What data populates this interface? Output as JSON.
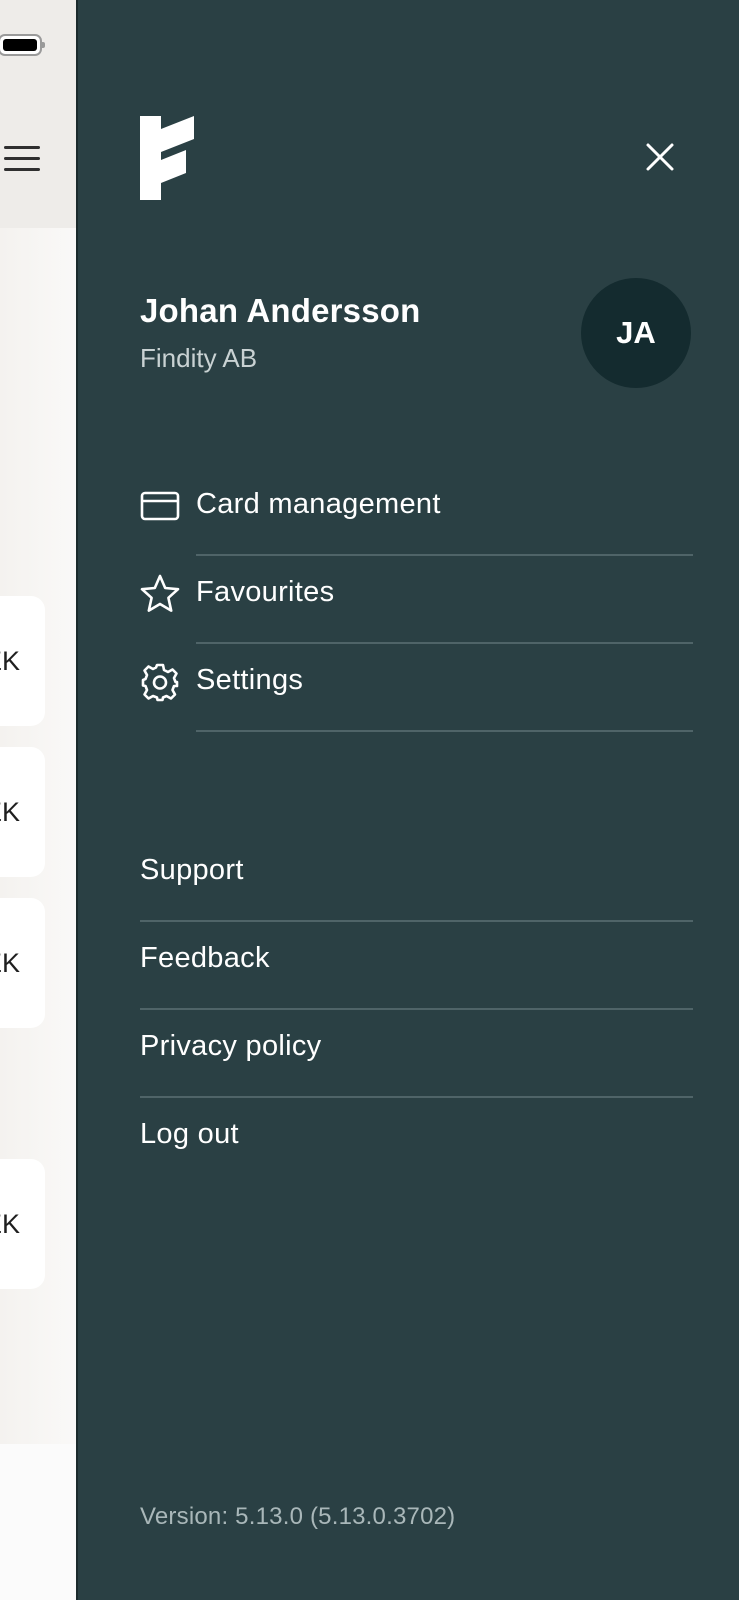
{
  "background_app": {
    "card_amount_fragments": [
      "EK",
      "EK",
      "EK",
      "EK"
    ]
  },
  "drawer": {
    "user": {
      "name": "Johan Andersson",
      "company": "Findity AB",
      "initials": "JA"
    },
    "menu": [
      {
        "label": "Card management",
        "icon": "credit-card-icon"
      },
      {
        "label": "Favourites",
        "icon": "star-icon"
      },
      {
        "label": "Settings",
        "icon": "gear-icon"
      }
    ],
    "links": [
      {
        "label": "Support"
      },
      {
        "label": "Feedback"
      },
      {
        "label": "Privacy policy"
      },
      {
        "label": "Log out"
      }
    ],
    "version": "Version: 5.13.0 (5.13.0.3702)"
  },
  "colors": {
    "drawer_bg": "#2a4044",
    "avatar_bg": "#142b2f",
    "divider": "#4f6468",
    "text_primary": "#ffffff",
    "text_secondary": "#c9d2d3"
  }
}
